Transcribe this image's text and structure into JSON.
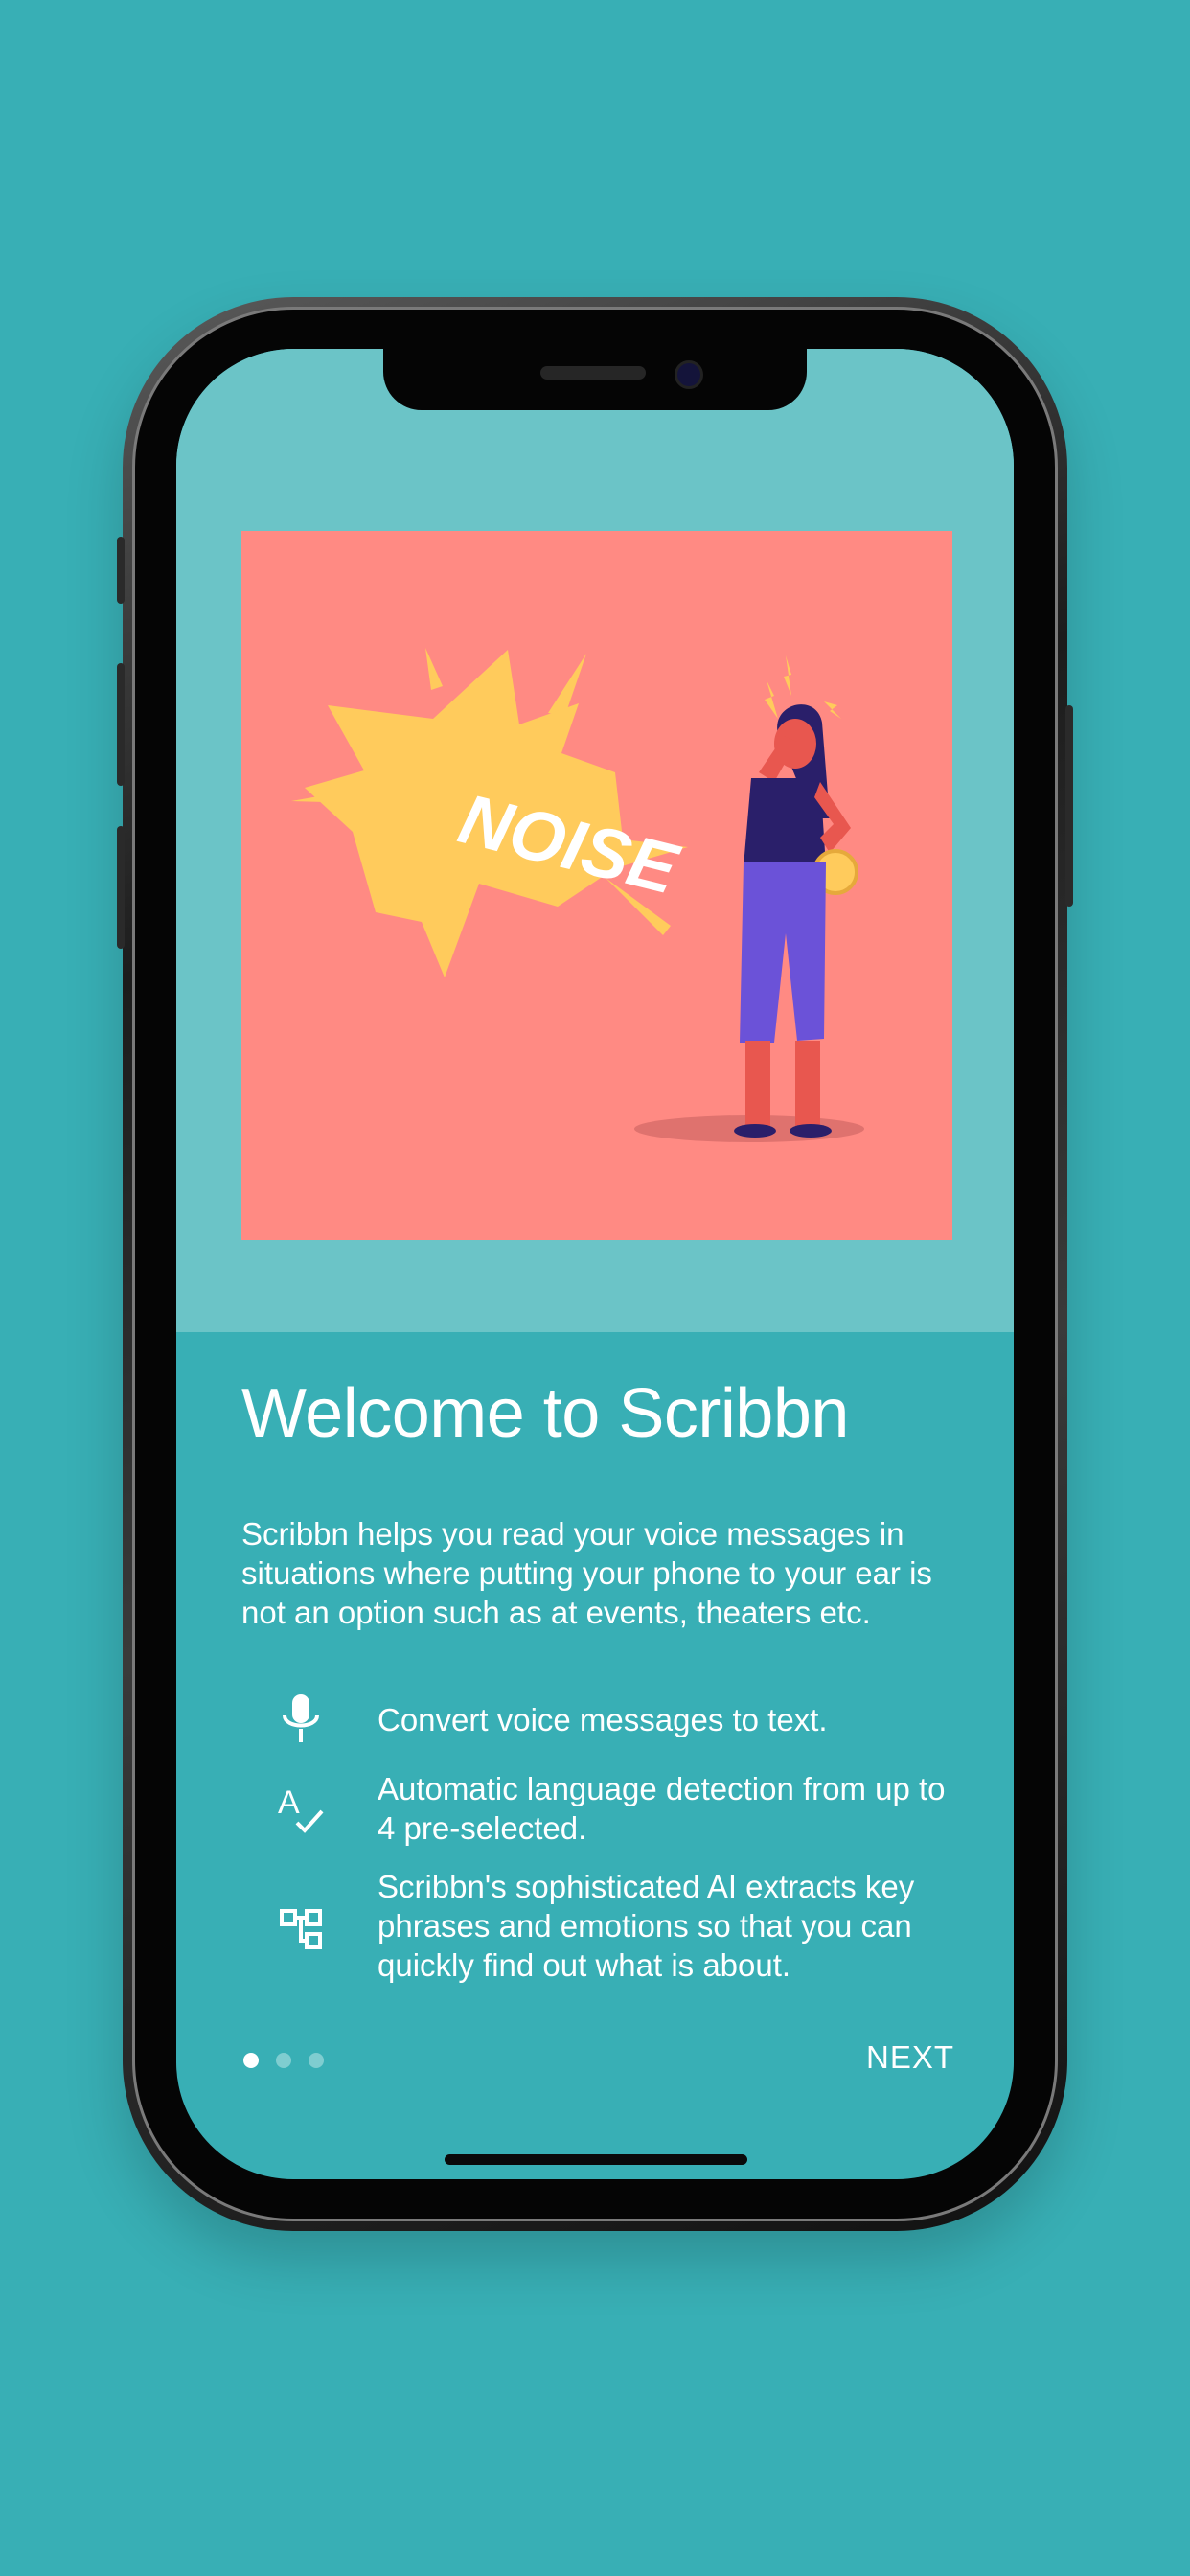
{
  "onboarding": {
    "title": "Welcome to Scribbn",
    "description": "Scribbn helps you read your voice messages in situations where putting your phone to your ear is not an option such as at events, theaters etc.",
    "illustration_text": "NOISE",
    "features": [
      {
        "icon": "microphone-icon",
        "text": "Convert voice messages to text."
      },
      {
        "icon": "spell-check-icon",
        "text": "Automatic language detection from up to 4 pre-selected."
      },
      {
        "icon": "hierarchy-icon",
        "text": "Scribbn's sophisticated AI extracts key phrases and emotions so that you can quickly find out what is about."
      }
    ],
    "pagination": {
      "total": 3,
      "active": 1
    },
    "next_label": "NEXT"
  },
  "colors": {
    "background": "#38afb5",
    "screen_top": "#6bc4c7",
    "illustration_bg": "#ff8a83",
    "burst": "#ffcb5c",
    "text": "#ffffff"
  }
}
